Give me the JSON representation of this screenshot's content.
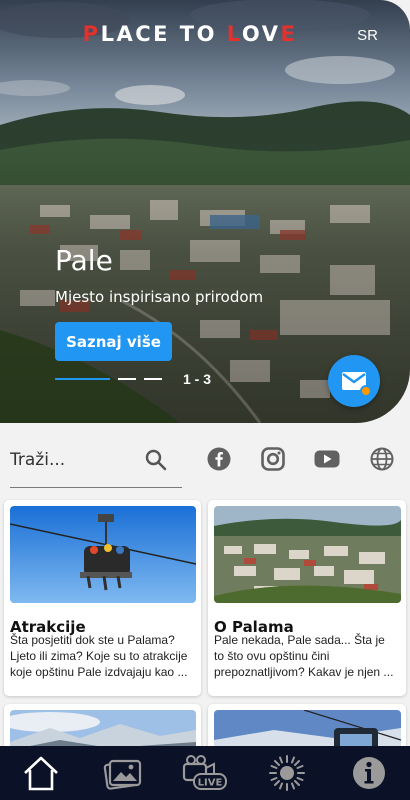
{
  "header": {
    "logo_parts": [
      "P",
      "LA",
      "CE TO ",
      "L",
      "OV",
      "E"
    ],
    "language": "SR"
  },
  "hero": {
    "city": "Pale",
    "subtitle": "Mjesto inspirisano prirodom",
    "button_label": "Saznaj više",
    "slide_counter": "1 - 3"
  },
  "search": {
    "placeholder": "Traži..."
  },
  "social": [
    "facebook-icon",
    "instagram-icon",
    "youtube-icon",
    "globe-icon"
  ],
  "cards": [
    {
      "title": "Atrakcije",
      "text": "Šta posjetiti dok ste u Palama? Ljeto ili zima? Koje su to atrakcije koje opštinu Pale izdvajaju kao ..."
    },
    {
      "title": "O Palama",
      "text": "Pale nekada, Pale sada... Šta je to što ovu opštinu čini prepoznatljivom? Kakav je njen ..."
    }
  ],
  "bottom_nav": [
    "home-icon",
    "gallery-icon",
    "live-icon",
    "weather-icon",
    "info-icon"
  ],
  "bottom_nav_live_label": "LIVE",
  "colors": {
    "accent": "#2196f3",
    "logo_red": "#e4312c",
    "nav_bg": "#0b1126",
    "notification": "#ff9800"
  }
}
